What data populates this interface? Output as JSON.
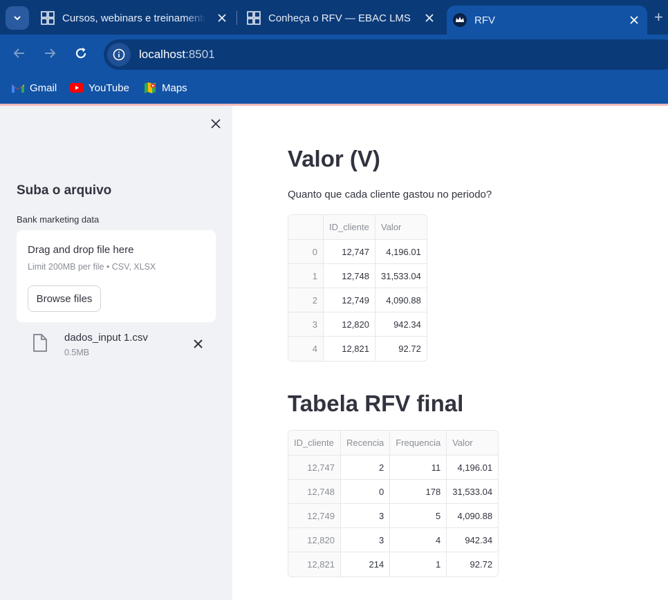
{
  "browser": {
    "tabs": [
      {
        "title": "Cursos, webinars e treinamentos",
        "icon": "ebac-logo-icon"
      },
      {
        "title": "Conheça o RFV — EBAC LMS",
        "icon": "ebac-logo-icon"
      },
      {
        "title": "RFV",
        "icon": "streamlit-crown-icon"
      }
    ],
    "url_host": "localhost",
    "url_port": ":8501",
    "bookmarks": [
      {
        "label": "Gmail",
        "icon": "gmail-icon"
      },
      {
        "label": "YouTube",
        "icon": "youtube-icon"
      },
      {
        "label": "Maps",
        "icon": "maps-icon"
      }
    ]
  },
  "sidebar": {
    "heading": "Suba o arquivo",
    "uploader_label": "Bank marketing data",
    "dropzone_title": "Drag and drop file here",
    "dropzone_limit": "Limit 200MB per file • CSV, XLSX",
    "browse_label": "Browse files",
    "file_name": "dados_input 1.csv",
    "file_size": "0.5MB"
  },
  "main": {
    "valor_heading": "Valor (V)",
    "valor_question": "Quanto que cada cliente gastou no periodo?",
    "valor_table": {
      "columns": [
        "",
        "ID_cliente",
        "Valor"
      ],
      "rows": [
        [
          "0",
          "12,747",
          "4,196.01"
        ],
        [
          "1",
          "12,748",
          "31,533.04"
        ],
        [
          "2",
          "12,749",
          "4,090.88"
        ],
        [
          "3",
          "12,820",
          "942.34"
        ],
        [
          "4",
          "12,821",
          "92.72"
        ]
      ]
    },
    "rfv_heading": "Tabela RFV final",
    "rfv_table": {
      "columns": [
        "ID_cliente",
        "Recencia",
        "Frequencia",
        "Valor"
      ],
      "rows": [
        [
          "12,747",
          "2",
          "11",
          "4,196.01"
        ],
        [
          "12,748",
          "0",
          "178",
          "31,533.04"
        ],
        [
          "12,749",
          "3",
          "5",
          "4,090.88"
        ],
        [
          "12,820",
          "3",
          "4",
          "942.34"
        ],
        [
          "12,821",
          "214",
          "1",
          "92.72"
        ]
      ]
    }
  }
}
